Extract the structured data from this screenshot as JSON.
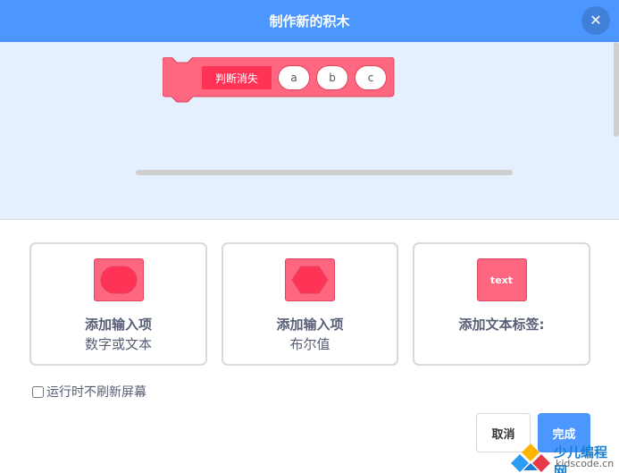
{
  "dialog": {
    "title": "制作新的积木",
    "close_icon": "close-icon"
  },
  "block": {
    "label": "判断消失",
    "args": [
      "a",
      "b",
      "c"
    ],
    "color": "#ff6680",
    "label_color": "#ff3355"
  },
  "options": [
    {
      "line1": "添加输入项",
      "line2": "数字或文本",
      "icon": "round-input-icon"
    },
    {
      "line1": "添加输入项",
      "line2": "布尔值",
      "icon": "boolean-input-icon"
    },
    {
      "line1": "添加文本标签:",
      "line2": "",
      "icon": "text-label-icon",
      "icon_text": "text"
    }
  ],
  "checkbox": {
    "label": "运行时不刷新屏幕",
    "checked": false
  },
  "buttons": {
    "cancel": "取消",
    "done": "完成"
  },
  "watermark": {
    "title": "少儿编程网",
    "url": "kidscode.cn"
  },
  "colors": {
    "accent": "#4c97ff",
    "workspace_bg": "#e5f0ff",
    "block": "#ff6680"
  }
}
